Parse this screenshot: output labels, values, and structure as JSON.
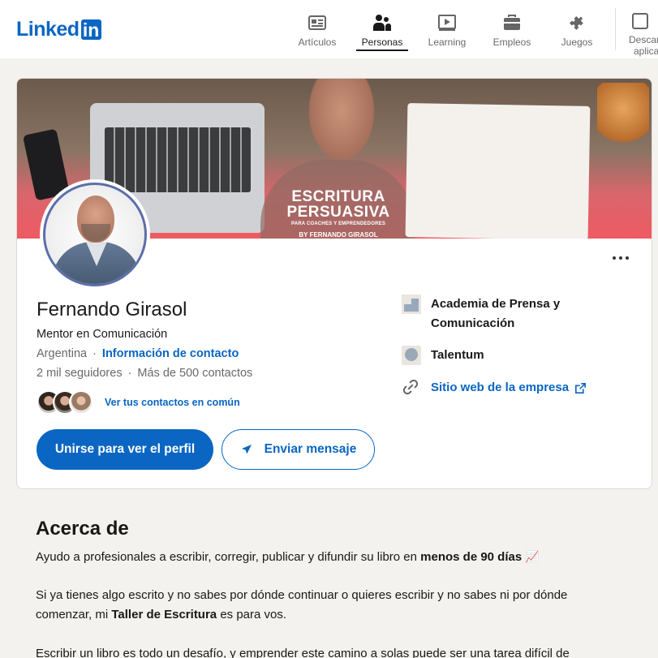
{
  "nav": {
    "logo_text": "Linked",
    "logo_box": "in",
    "items": [
      {
        "label": "Artículos",
        "icon": "articles-icon"
      },
      {
        "label": "Personas",
        "icon": "people-icon",
        "active": true
      },
      {
        "label": "Learning",
        "icon": "learning-icon"
      },
      {
        "label": "Empleos",
        "icon": "briefcase-icon"
      },
      {
        "label": "Juegos",
        "icon": "puzzle-icon"
      }
    ],
    "download_line1": "Descar",
    "download_line2": "aplica"
  },
  "banner": {
    "title": "ESCRITURA PERSUASIVA",
    "subtitle": "PARA COACHES Y EMPRENDEDORES",
    "byline": "BY FERNANDO GIRASOL"
  },
  "profile": {
    "name": "Fernando Girasol",
    "headline": "Mentor en Comunicación",
    "location": "Argentina",
    "contact_info": "Información de contacto",
    "followers": "2 mil seguidores",
    "connections": "Más de 500 contactos",
    "mutual_link": "Ver tus contactos en común",
    "join_button": "Unirse para ver el perfil",
    "message_button": "Enviar mensaje"
  },
  "sidebar": {
    "company": "Academia de Prensa y Comunicación",
    "company_line1": "Academia de Prensa y",
    "company_line2": "Comunicación",
    "education": "Talentum",
    "website": "Sitio web de la empresa"
  },
  "about": {
    "title": "Acerca de",
    "p1_a": "Ayudo a profesionales a escribir, corregir, publicar y difundir su libro en ",
    "p1_b": "menos de 90 días",
    "p1_emoji": "📈",
    "p2_line1": "Si ya tienes algo escrito y no sabes por dónde continuar o quieres escribir y no sabes ni por dónde",
    "p2_a": "comenzar, mi ",
    "p2_b": "Taller de Escritura",
    "p2_c": " es para vos.",
    "p3": "Escribir un libro es todo un desafío, y emprender este camino a solas puede ser una tarea difícil de"
  },
  "colors": {
    "accent": "#0a66c2",
    "page_bg": "#f4f2ee",
    "avatar_ring": "#5b6ea8"
  }
}
